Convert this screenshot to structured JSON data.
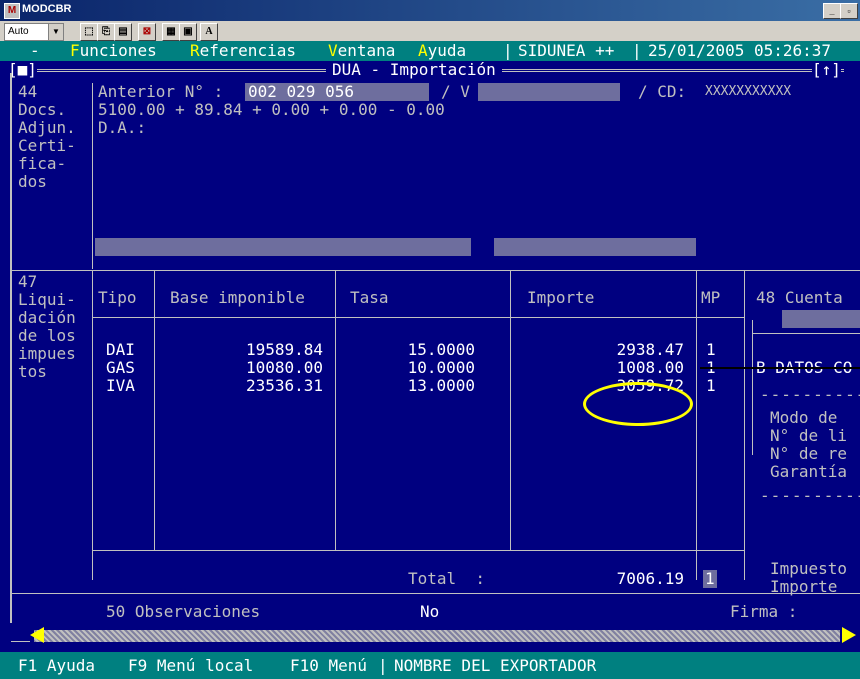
{
  "window": {
    "title": "MODCBR",
    "buttons": [
      "_",
      "▫"
    ]
  },
  "toolbar": {
    "zoom_value": "Auto"
  },
  "menu": {
    "dash": "-",
    "items": [
      {
        "hot": "F",
        "rest": "unciones"
      },
      {
        "hot": "R",
        "rest": "eferencias"
      },
      {
        "hot": "V",
        "rest": "entana"
      },
      {
        "hot": "A",
        "rest": "yuda"
      }
    ],
    "system": "SIDUNEA ++",
    "datetime": "25/01/2005 05:26:37"
  },
  "form": {
    "title": "DUA - Importación",
    "box44": {
      "label_lines": [
        "44",
        "Docs.",
        "Adjun.",
        "Certi-",
        "fica-",
        "dos"
      ],
      "anterior_label": "Anterior N° :",
      "anterior_value": "002 029 056",
      "v_label": "/ V",
      "cd_label": "/ CD:",
      "cd_value": "XXXXXXXXXXX",
      "sum_line": "5100.00 + 89.84 + 0.00 + 0.00 - 0.00",
      "da_label": "D.A.:"
    },
    "box47": {
      "label_lines": [
        "47",
        "Liqui-",
        "dación",
        "de los",
        "impues",
        "tos"
      ],
      "headers": {
        "tipo": "Tipo",
        "base": "Base imponible",
        "tasa": "Tasa",
        "importe": "Importe",
        "mp": "MP"
      },
      "rows": [
        {
          "tipo": "DAI",
          "base": "19589.84",
          "tasa": "15.0000",
          "importe": "2938.47",
          "mp": "1"
        },
        {
          "tipo": "GAS",
          "base": "10080.00",
          "tasa": "10.0000",
          "importe": "1008.00",
          "mp": "1"
        },
        {
          "tipo": "IVA",
          "base": "23536.31",
          "tasa": "13.0000",
          "importe": "3059.72",
          "mp": "1"
        }
      ],
      "total_label": "Total  :",
      "total_value": "7006.19",
      "total_mp": "1"
    },
    "box48": {
      "title": "48 Cuenta",
      "datos": "B DATOS CO",
      "lines": [
        "Modo de",
        "N° de li",
        "N° de re",
        "Garantía"
      ],
      "impuesto": "Impuesto",
      "importe": "Importe"
    },
    "box50": {
      "label": "50 Observaciones",
      "value": "No",
      "firma": "Firma :"
    },
    "corner_left": "[■]",
    "corner_right": "[↑]"
  },
  "statusbar": {
    "f1": "F1 Ayuda",
    "f9": "F9 Menú local",
    "f10": "F10 Menú",
    "field_name": "NOMBRE DEL EXPORTADOR"
  },
  "colors": {
    "terminal_bg": "#000080",
    "menubar_bg": "#008080",
    "highlight": "#ffff00",
    "text": "#c0c0c0"
  }
}
